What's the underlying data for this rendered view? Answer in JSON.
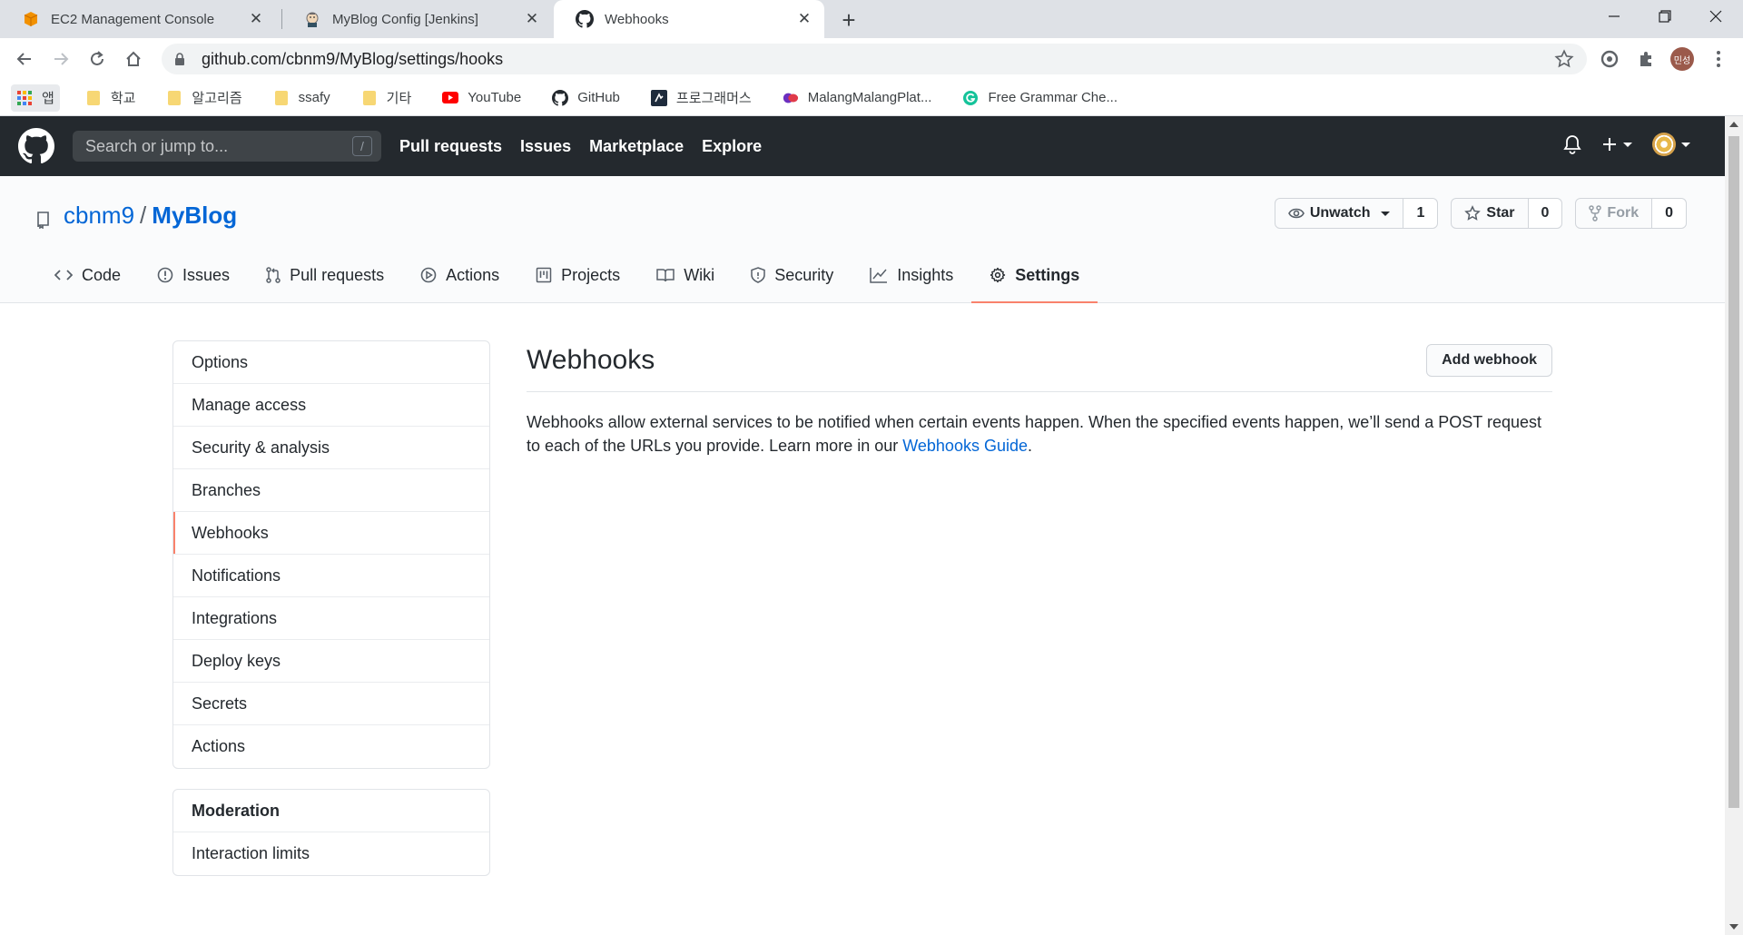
{
  "browser": {
    "tabs": [
      {
        "title": "EC2 Management Console",
        "icon": "aws-box-icon"
      },
      {
        "title": "MyBlog Config [Jenkins]",
        "icon": "jenkins-icon"
      },
      {
        "title": "Webhooks",
        "icon": "github-icon",
        "active": true
      }
    ],
    "url": "github.com/cbnm9/MyBlog/settings/hooks",
    "profile_initials": "민성",
    "bookmarks": [
      {
        "label": "앱",
        "icon": "apps-grid-icon"
      },
      {
        "label": "학교",
        "icon": "folder-icon"
      },
      {
        "label": "알고리즘",
        "icon": "folder-icon"
      },
      {
        "label": "ssafy",
        "icon": "folder-icon"
      },
      {
        "label": "기타",
        "icon": "folder-icon"
      },
      {
        "label": "YouTube",
        "icon": "youtube-icon"
      },
      {
        "label": "GitHub",
        "icon": "github-icon"
      },
      {
        "label": "프로그래머스",
        "icon": "programmers-icon"
      },
      {
        "label": "MalangMalangPlat...",
        "icon": "malang-icon"
      },
      {
        "label": "Free Grammar Che...",
        "icon": "grammarly-icon"
      }
    ]
  },
  "header": {
    "search_placeholder": "Search or jump to...",
    "search_key": "/",
    "nav": [
      "Pull requests",
      "Issues",
      "Marketplace",
      "Explore"
    ]
  },
  "repo": {
    "owner": "cbnm9",
    "separator": "/",
    "name": "MyBlog",
    "watch_label": "Unwatch",
    "watch_count": "1",
    "star_label": "Star",
    "star_count": "0",
    "fork_label": "Fork",
    "fork_count": "0",
    "tabs": [
      {
        "label": "Code",
        "icon": "code-icon"
      },
      {
        "label": "Issues",
        "icon": "issue-icon"
      },
      {
        "label": "Pull requests",
        "icon": "pull-request-icon"
      },
      {
        "label": "Actions",
        "icon": "play-icon"
      },
      {
        "label": "Projects",
        "icon": "project-icon"
      },
      {
        "label": "Wiki",
        "icon": "book-icon"
      },
      {
        "label": "Security",
        "icon": "shield-icon"
      },
      {
        "label": "Insights",
        "icon": "graph-icon"
      },
      {
        "label": "Settings",
        "icon": "gear-icon",
        "selected": true
      }
    ]
  },
  "sidebar": {
    "items": [
      "Options",
      "Manage access",
      "Security & analysis",
      "Branches",
      "Webhooks",
      "Notifications",
      "Integrations",
      "Deploy keys",
      "Secrets",
      "Actions"
    ],
    "selected": "Webhooks",
    "moderation_heading": "Moderation",
    "moderation_items": [
      "Interaction limits"
    ]
  },
  "main": {
    "title": "Webhooks",
    "add_button": "Add webhook",
    "description": "Webhooks allow external services to be notified when certain events happen. When the specified events happen, we’ll send a POST request to each of the URLs you provide. Learn more in our ",
    "link_text": "Webhooks Guide",
    "description_end": "."
  },
  "colors": {
    "accent": "#f9826c",
    "link": "#0366d6",
    "header_bg": "#24292e"
  }
}
